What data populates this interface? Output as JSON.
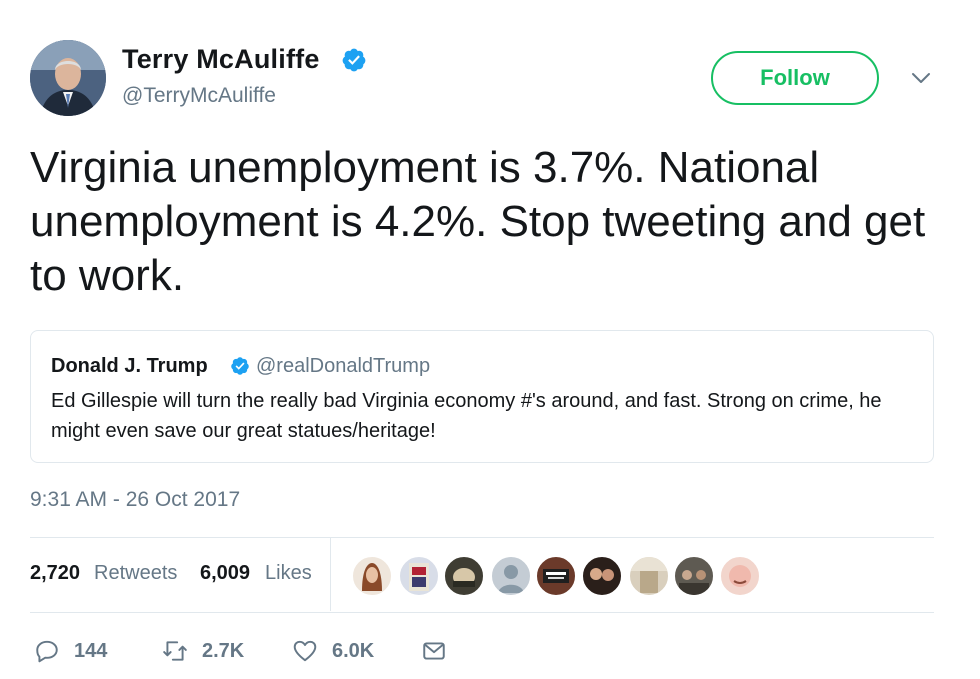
{
  "author": {
    "name": "Terry McAuliffe",
    "handle": "@TerryMcAuliffe",
    "avatar_icon": "profile-photo",
    "verified_icon": "verified-badge-icon"
  },
  "header": {
    "follow_label": "Follow",
    "menu_icon": "chevron-down-icon",
    "follow_color": "#17bf63"
  },
  "tweet": {
    "text": "Virginia unemployment is 3.7%. National unemployment is 4.2%. Stop tweeting and get to work.",
    "timestamp": "9:31 AM - 26 Oct 2017"
  },
  "quoted_tweet": {
    "name": "Donald J. Trump",
    "handle": "@realDonaldTrump",
    "text": "Ed Gillespie will turn the really bad Virginia economy #'s around, and fast. Strong on crime, he might even save our great statues/heritage!"
  },
  "stats": {
    "retweets_count": "2,720",
    "retweets_label": "Retweets",
    "likes_count": "6,009",
    "likes_label": "Likes"
  },
  "likers": [
    {
      "icon": "liker-avatar-1",
      "color": "#e7d7c9"
    },
    {
      "icon": "liker-avatar-2",
      "color": "#c9d4e8"
    },
    {
      "icon": "liker-avatar-3",
      "color": "#3b3b2f"
    },
    {
      "icon": "liker-avatar-default",
      "color": "#aab8c2"
    },
    {
      "icon": "liker-avatar-5",
      "color": "#6b3a2a"
    },
    {
      "icon": "liker-avatar-6",
      "color": "#2e2320"
    },
    {
      "icon": "liker-avatar-7",
      "color": "#d9cfbd"
    },
    {
      "icon": "liker-avatar-8",
      "color": "#5e5a52"
    },
    {
      "icon": "liker-avatar-9",
      "color": "#f2c8c0"
    }
  ],
  "actions": {
    "reply_count": "144",
    "retweet_count": "2.7K",
    "like_count": "6.0K",
    "reply_icon": "reply-icon",
    "retweet_icon": "retweet-icon",
    "like_icon": "heart-icon",
    "dm_icon": "envelope-icon",
    "icon_color": "#657786"
  },
  "colors": {
    "verified": "#1da1f2",
    "text_primary": "#14171a",
    "text_secondary": "#657786",
    "border": "#e1e8ed"
  }
}
